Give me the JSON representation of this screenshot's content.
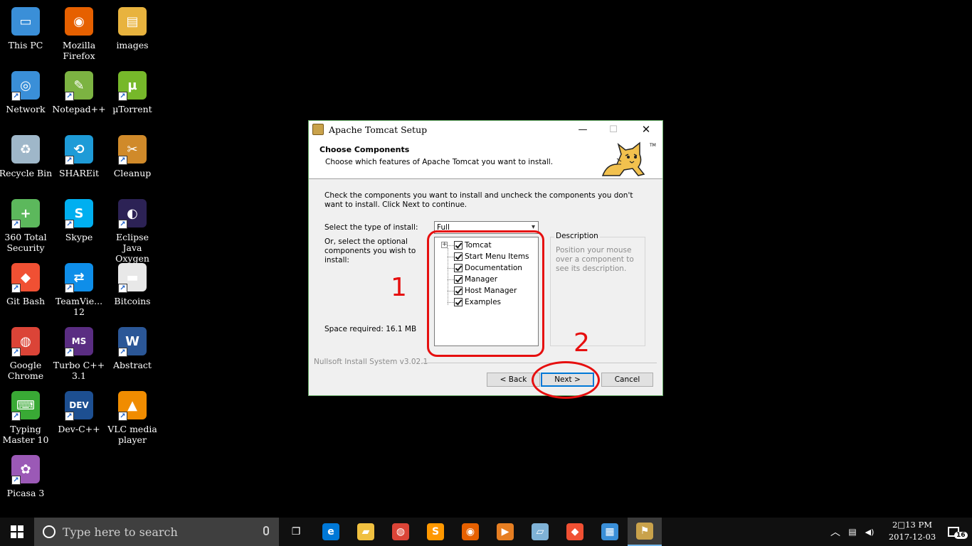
{
  "desktop": {
    "icons": [
      {
        "label": "This PC",
        "color": "#3a8fd8",
        "glyph": "▭"
      },
      {
        "label": "Mozilla\nFirefox",
        "color": "#e66000",
        "glyph": "◉"
      },
      {
        "label": "images",
        "color": "#e8b33e",
        "glyph": "▤"
      },
      {
        "label": "Network",
        "color": "#3a8fd8",
        "glyph": "◎"
      },
      {
        "label": "Notepad++",
        "color": "#7cb342",
        "glyph": "✎"
      },
      {
        "label": "µTorrent",
        "color": "#76b82a",
        "glyph": "µ"
      },
      {
        "label": "Recycle Bin",
        "color": "#9fb7c9",
        "glyph": "♻"
      },
      {
        "label": "SHAREit",
        "color": "#1e9bd7",
        "glyph": "⟲"
      },
      {
        "label": "Cleanup",
        "color": "#d08a2a",
        "glyph": "✂"
      },
      {
        "label": "360 Total\nSecurity",
        "color": "#5cb85c",
        "glyph": "+"
      },
      {
        "label": "Skype",
        "color": "#00aff0",
        "glyph": "S"
      },
      {
        "label": "Eclipse Java\nOxygen",
        "color": "#2c2255",
        "glyph": "◐"
      },
      {
        "label": "Git Bash",
        "color": "#f05033",
        "glyph": "◆"
      },
      {
        "label": "TeamVie...\n12",
        "color": "#0e8ee9",
        "glyph": "⇄"
      },
      {
        "label": "Bitcoins",
        "color": "#e8e8e8",
        "glyph": "▬"
      },
      {
        "label": "Google\nChrome",
        "color": "#db4437",
        "glyph": "◍"
      },
      {
        "label": "Turbo C++\n3.1",
        "color": "#5a2d82",
        "glyph": "MS"
      },
      {
        "label": "Abstract",
        "color": "#2b5797",
        "glyph": "W"
      },
      {
        "label": "Typing\nMaster 10",
        "color": "#39a935",
        "glyph": "⌨"
      },
      {
        "label": "Dev-C++",
        "color": "#1d4f91",
        "glyph": "DEV"
      },
      {
        "label": "VLC media\nplayer",
        "color": "#f08c00",
        "glyph": "▲"
      },
      {
        "label": "Picasa 3",
        "color": "#9b59b6",
        "glyph": "✿"
      }
    ]
  },
  "window": {
    "title": "Apache Tomcat Setup",
    "minimize": "—",
    "maximize": "☐",
    "close": "✕",
    "header_title": "Choose Components",
    "header_subtitle": "Choose which features of Apache Tomcat you want to install.",
    "tm": "TM",
    "instructions": "Check the components you want to install and uncheck the components you don't want to install. Click Next to continue.",
    "install_type_label": "Select the type of install:",
    "install_type_value": "Full",
    "optional_label": "Or, select the optional components you wish to install:",
    "components": [
      "Tomcat",
      "Start Menu Items",
      "Documentation",
      "Manager",
      "Host Manager",
      "Examples"
    ],
    "space_required": "Space required: 16.1 MB",
    "description_title": "Description",
    "description_text": "Position your mouse over a component to see its description.",
    "nsis_label": "Nullsoft Install System v3.02.1",
    "back_label": "< Back",
    "next_label": "Next >",
    "cancel_label": "Cancel"
  },
  "annotations": {
    "label_1": "1",
    "label_2": "2",
    "color": "#e60f0f"
  },
  "taskbar": {
    "search_placeholder": "Type here to search",
    "apps": [
      {
        "name": "task-view",
        "glyph": "❐",
        "color": "#101010"
      },
      {
        "name": "edge",
        "glyph": "e",
        "color": "#0078d7"
      },
      {
        "name": "file-explorer",
        "glyph": "▰",
        "color": "#f0c040"
      },
      {
        "name": "chrome",
        "glyph": "◍",
        "color": "#db4437"
      },
      {
        "name": "sublime-text",
        "glyph": "S",
        "color": "#ff9800"
      },
      {
        "name": "firefox",
        "glyph": "◉",
        "color": "#e66000"
      },
      {
        "name": "media-player",
        "glyph": "▶",
        "color": "#e67e22"
      },
      {
        "name": "notes",
        "glyph": "▱",
        "color": "#7fb2d6"
      },
      {
        "name": "git",
        "glyph": "◆",
        "color": "#f05033"
      },
      {
        "name": "control-panel",
        "glyph": "▦",
        "color": "#3a8fd8"
      },
      {
        "name": "tomcat",
        "glyph": "⚑",
        "color": "#c9a24b"
      }
    ],
    "tray": {
      "chevron": "︿",
      "network": "▤",
      "volume": "◀)",
      "notifications_count": "16"
    },
    "clock": {
      "time": "2□13 PM",
      "date": "2017-12-03"
    }
  }
}
